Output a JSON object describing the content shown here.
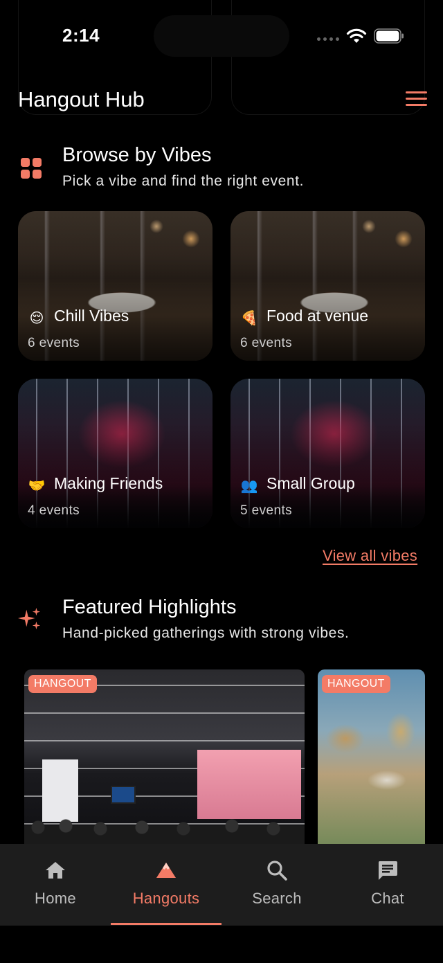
{
  "status_bar": {
    "time": "2:14"
  },
  "header": {
    "title": "Hangout Hub",
    "menu_icon": "hamburger-menu-icon"
  },
  "browse": {
    "title": "Browse by Vibes",
    "subtitle": "Pick a vibe and find the right event.",
    "icon": "grid-icon",
    "vibes": [
      {
        "emoji": "😌",
        "name": "Chill Vibes",
        "count": "6 events"
      },
      {
        "emoji": "🍕",
        "name": "Food at venue",
        "count": "6 events"
      },
      {
        "emoji": "🤝",
        "name": "Making Friends",
        "count": "4 events"
      },
      {
        "emoji": "👥",
        "name": "Small Group",
        "count": "5 events"
      }
    ],
    "view_all": "View all vibes"
  },
  "featured": {
    "title": "Featured Highlights",
    "subtitle": "Hand-picked gatherings with strong vibes.",
    "icon": "sparkles-icon",
    "cards": [
      {
        "tag": "HANGOUT"
      },
      {
        "tag": "HANGOUT"
      }
    ]
  },
  "tab_bar": {
    "active": "Hangouts",
    "items": [
      {
        "label": "Home",
        "icon": "home-icon"
      },
      {
        "label": "Hangouts",
        "icon": "mountain-icon"
      },
      {
        "label": "Search",
        "icon": "search-icon"
      },
      {
        "label": "Chat",
        "icon": "chat-icon"
      }
    ]
  },
  "colors": {
    "accent": "#f37b66",
    "background": "#000000",
    "tab_bar": "#1d1d1d"
  }
}
